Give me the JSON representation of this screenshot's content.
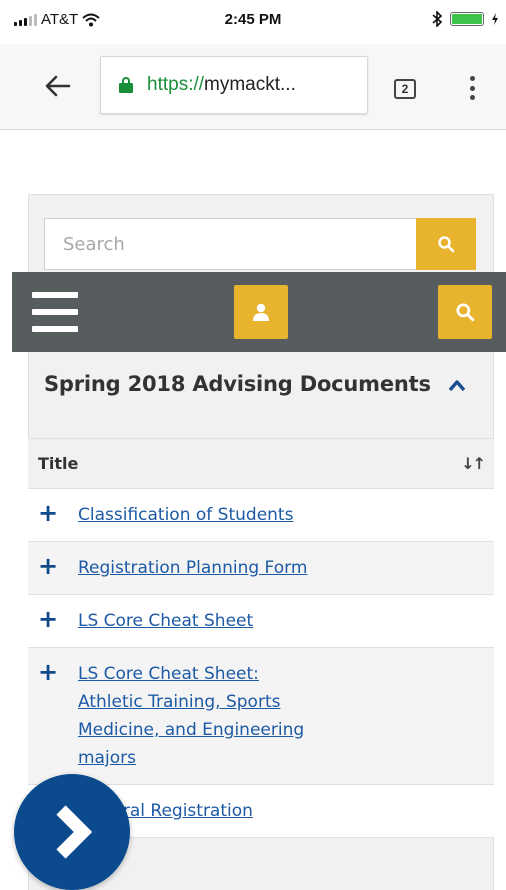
{
  "status": {
    "carrier": "AT&T",
    "time": "2:45 PM",
    "battery_color": "#3cc448"
  },
  "browser": {
    "url_scheme": "https://",
    "url_rest": "mymackt...",
    "tab_count": "2"
  },
  "site": {
    "search_placeholder": "Search",
    "accent_color": "#e9b42d",
    "nav_color": "#575c5f",
    "section_title": "Spring 2018 Advising Documents",
    "table": {
      "header_title": "Title",
      "rows": [
        {
          "title": "Classification of Students"
        },
        {
          "title": "Registration Planning Form"
        },
        {
          "title": "LS Core Cheat Sheet"
        },
        {
          "title": "LS Core Cheat Sheet: Athletic Training, Sports Medicine, and Engineering majors"
        },
        {
          "title": "General Registration"
        }
      ]
    }
  },
  "icons": {
    "back": "arrow-left",
    "lock": "lock",
    "menu": "more-vertical",
    "search": "magnifier",
    "account": "user",
    "collapse": "chevron-up",
    "sort": "sort-arrows",
    "expand": "plus",
    "next": "chevron-right"
  }
}
